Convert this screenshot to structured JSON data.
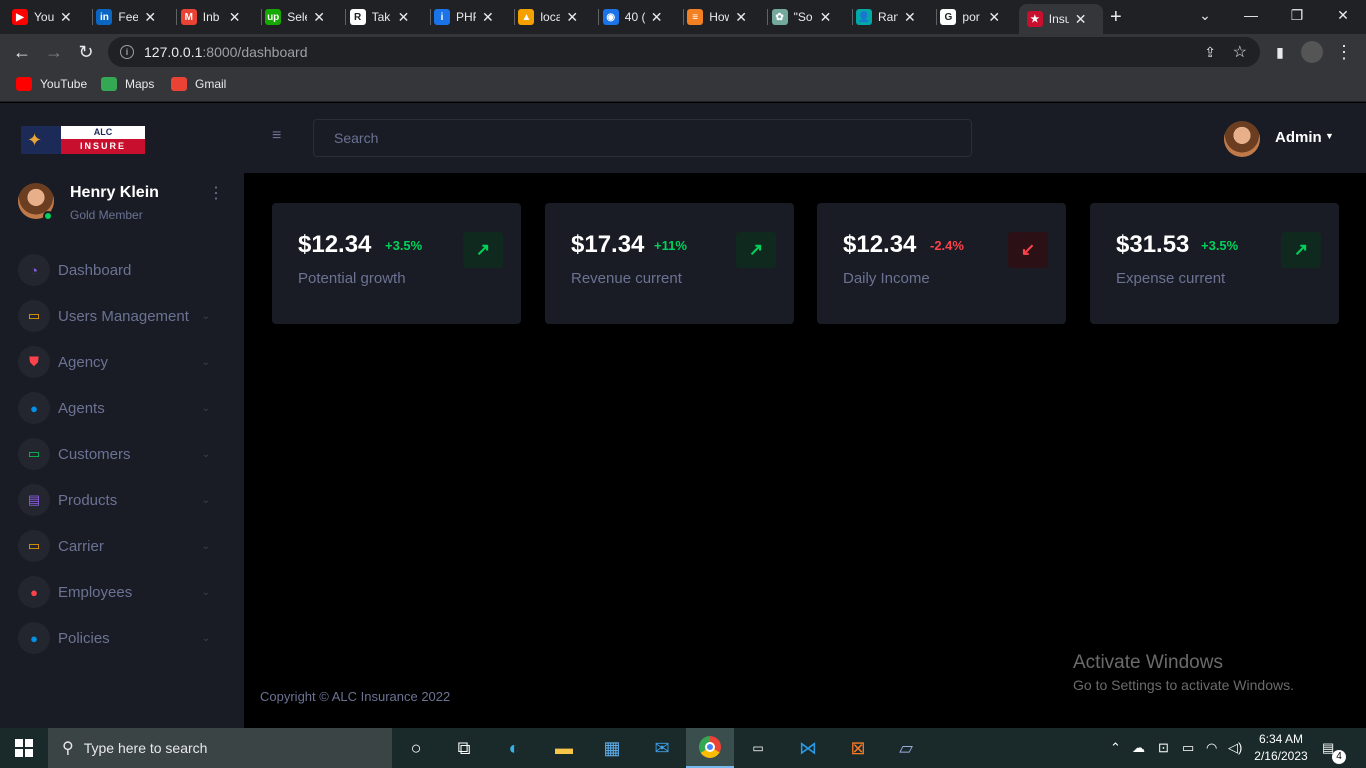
{
  "browser": {
    "tabs": [
      {
        "title": "You",
        "color": "#ff0000",
        "glyph": "▶"
      },
      {
        "title": "Fee",
        "color": "#0a66c2",
        "glyph": "in"
      },
      {
        "title": "Inb",
        "color": "#ea4335",
        "glyph": "M"
      },
      {
        "title": "Sele",
        "color": "#14a800",
        "glyph": "up"
      },
      {
        "title": "Tak",
        "color": "#ffffff",
        "glyph": "R"
      },
      {
        "title": "PHF",
        "color": "#1a73e8",
        "glyph": "i"
      },
      {
        "title": "loca",
        "color": "#f4a100",
        "glyph": "▲"
      },
      {
        "title": "40 (",
        "color": "#1a73e8",
        "glyph": "◉"
      },
      {
        "title": "How",
        "color": "#f48024",
        "glyph": "≡"
      },
      {
        "title": "\"So",
        "color": "#74aa9c",
        "glyph": "✿"
      },
      {
        "title": "Ran",
        "color": "#00a8a8",
        "glyph": "👤"
      },
      {
        "title": "por",
        "color": "#ffffff",
        "glyph": "G"
      },
      {
        "title": "Insu",
        "color": "#c8102e",
        "glyph": "★"
      }
    ],
    "new_tab": "+",
    "url_host": "127.0.0.1",
    "url_path": ":8000/dashboard",
    "bookmarks": [
      {
        "label": "YouTube",
        "color": "#ff0000"
      },
      {
        "label": "Maps",
        "color": "#34a853"
      },
      {
        "label": "Gmail",
        "color": "#ea4335"
      }
    ]
  },
  "brand": {
    "top": "ALC",
    "bottom": "INSURE"
  },
  "profile": {
    "name": "Henry Klein",
    "role": "Gold Member"
  },
  "sidebar": {
    "items": [
      {
        "label": "Dashboard",
        "icon": "gauge-icon",
        "color": "#8f5fe8",
        "glyph": "◔",
        "chevron": false
      },
      {
        "label": "Users Management",
        "icon": "laptop-icon",
        "color": "#ffab00",
        "glyph": "▭",
        "chevron": true
      },
      {
        "label": "Agency",
        "icon": "shield-icon",
        "color": "#fc424a",
        "glyph": "⛊",
        "chevron": true
      },
      {
        "label": "Agents",
        "icon": "person-icon",
        "color": "#0090e7",
        "glyph": "●",
        "chevron": true
      },
      {
        "label": "Customers",
        "icon": "monitor-icon",
        "color": "#00d25b",
        "glyph": "▭",
        "chevron": true
      },
      {
        "label": "Products",
        "icon": "archive-icon",
        "color": "#8f5fe8",
        "glyph": "▤",
        "chevron": true
      },
      {
        "label": "Carrier",
        "icon": "laptop-icon",
        "color": "#ffab00",
        "glyph": "▭",
        "chevron": true
      },
      {
        "label": "Employees",
        "icon": "account-icon",
        "color": "#fc424a",
        "glyph": "●",
        "chevron": true
      },
      {
        "label": "Policies",
        "icon": "account-circle-icon",
        "color": "#0090e7",
        "glyph": "●",
        "chevron": true
      }
    ]
  },
  "header": {
    "search_placeholder": "Search",
    "user": "Admin"
  },
  "cards": [
    {
      "amount": "$12.34",
      "change": "+3.5%",
      "label": "Potential growth",
      "trend": "up"
    },
    {
      "amount": "$17.34",
      "change": "+11%",
      "label": "Revenue current",
      "trend": "up"
    },
    {
      "amount": "$12.34",
      "change": "-2.4%",
      "label": "Daily Income",
      "trend": "down"
    },
    {
      "amount": "$31.53",
      "change": "+3.5%",
      "label": "Expense current",
      "trend": "up"
    }
  ],
  "footer": {
    "copyright": "Copyright © ALC Insurance 2022"
  },
  "watermark": {
    "line1": "Activate Windows",
    "line2": "Go to Settings to activate Windows."
  },
  "taskbar": {
    "search_placeholder": "Type here to search",
    "time": "6:34 AM",
    "date": "2/16/2023",
    "notifications": "4"
  }
}
